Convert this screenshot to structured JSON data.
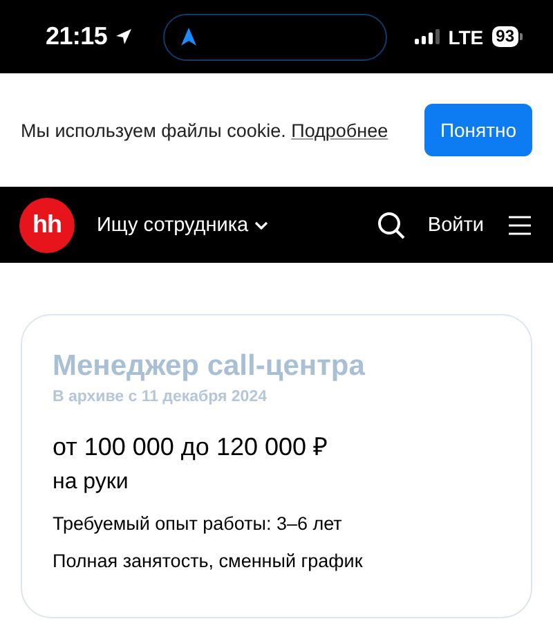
{
  "status_bar": {
    "time": "21:15",
    "network": "LTE",
    "battery": "93"
  },
  "cookie_banner": {
    "text": "Мы используем файлы cookie.",
    "link": "Подробнее",
    "button": "Понятно"
  },
  "header": {
    "logo": "hh",
    "mode": "Ищу сотрудника",
    "login": "Войти"
  },
  "vacancy": {
    "title": "Менеджер call-центра",
    "archived": "В архиве с 11 декабря 2024",
    "salary": "от 100 000 до 120 000 ₽",
    "salary_note": "на руки",
    "experience": "Требуемый опыт работы: 3–6 лет",
    "schedule": "Полная занятость, сменный график"
  }
}
